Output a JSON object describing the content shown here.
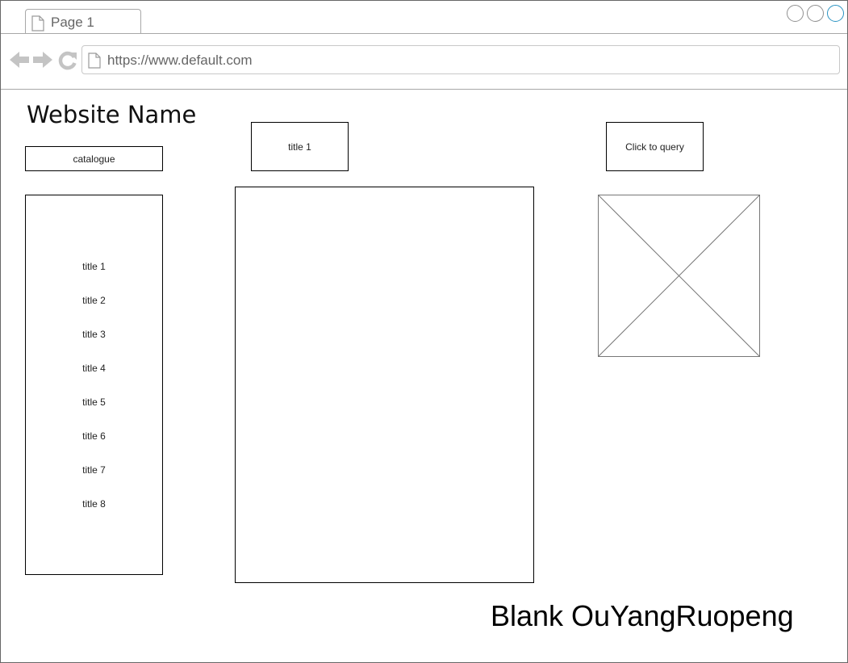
{
  "browser": {
    "tab_title": "Page 1",
    "url": "https://www.default.com",
    "window_buttons": [
      "minimize-icon",
      "maximize-icon",
      "close-icon"
    ],
    "accent_color": "#2a93c2"
  },
  "page": {
    "site_name": "Website Name",
    "catalogue_button": "catalogue",
    "title_button": "title 1",
    "query_button": "Click to query",
    "catalogue_items": [
      "title 1",
      "title 2",
      "title 3",
      "title 4",
      "title 5",
      "title 6",
      "title 7",
      "title 8"
    ],
    "image_placeholder": "image-placeholder-icon",
    "footer": "Blank OuYangRuopeng"
  }
}
